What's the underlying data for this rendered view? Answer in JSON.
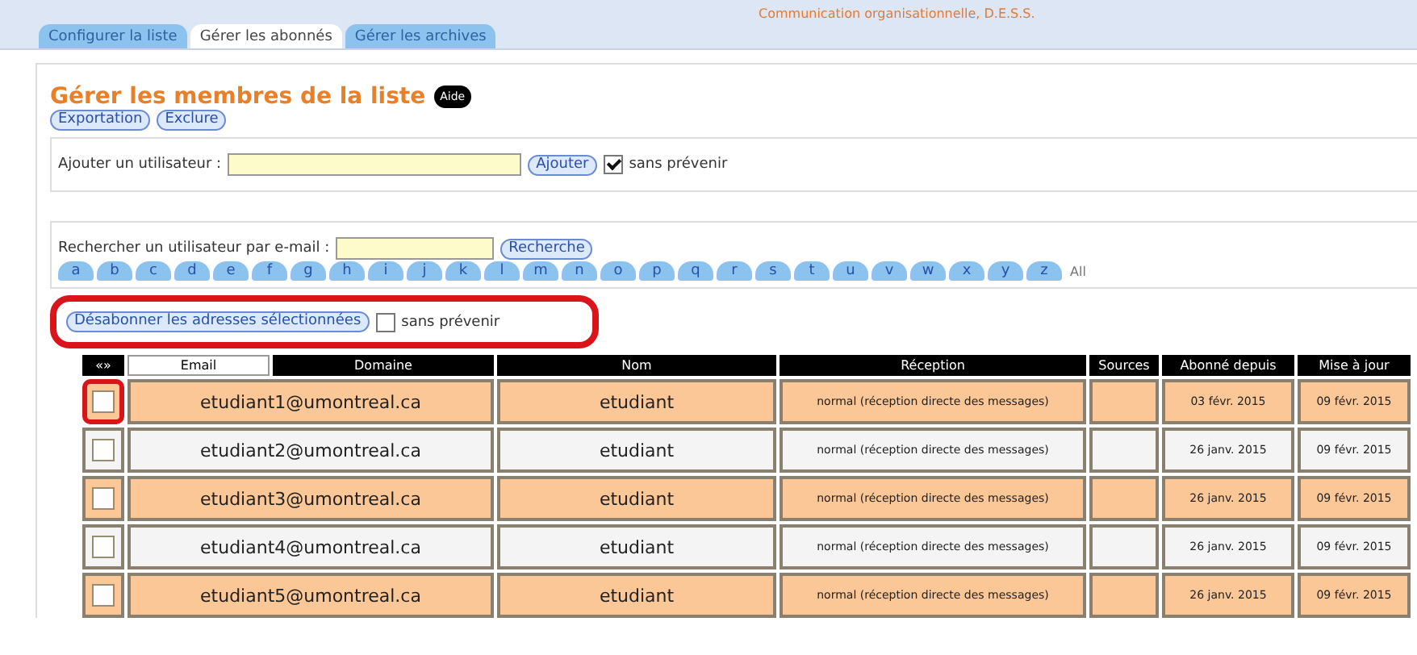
{
  "tabs": [
    {
      "label": "Configurer la liste",
      "selected": false
    },
    {
      "label": "Gérer les abonnés",
      "selected": true
    },
    {
      "label": "Gérer les archives",
      "selected": false
    }
  ],
  "list_title": "Communication organisationnelle, D.E.S.S.",
  "heading": "Gérer les membres de la liste",
  "help_badge": "Aide",
  "actions": [
    "Exportation",
    "Exclure"
  ],
  "add_user": {
    "label": "Ajouter un utilisateur :",
    "button": "Ajouter",
    "quiet_checked": true,
    "quiet_label": "sans prévenir"
  },
  "search": {
    "label": "Rechercher un utilisateur par e-mail :",
    "button": "Recherche"
  },
  "letters": [
    "a",
    "b",
    "c",
    "d",
    "e",
    "f",
    "g",
    "h",
    "i",
    "j",
    "k",
    "l",
    "m",
    "n",
    "o",
    "p",
    "q",
    "r",
    "s",
    "t",
    "u",
    "v",
    "w",
    "x",
    "y",
    "z"
  ],
  "all_letters": "All",
  "unsubscribe": {
    "button": "Désabonner les adresses sélectionnées",
    "quiet_checked": false,
    "quiet_label": "sans prévenir",
    "highlighted": true
  },
  "table": {
    "columns": [
      {
        "label": "«»",
        "selected": false
      },
      {
        "label": "Email",
        "selected": true
      },
      {
        "label": "Domaine",
        "selected": false
      },
      {
        "label": "Nom",
        "selected": false
      },
      {
        "label": "Réception",
        "selected": false
      },
      {
        "label": "Sources",
        "selected": false
      },
      {
        "label": "Abonné depuis",
        "selected": false
      },
      {
        "label": "Mise à jour",
        "selected": false
      }
    ],
    "rows": [
      {
        "checked": false,
        "highlighted": true,
        "email": "etudiant1@umontreal.ca",
        "name": "etudiant",
        "reception": "normal (réception directe des messages)",
        "since": "03 févr. 2015",
        "updated": "09 févr. 2015"
      },
      {
        "checked": false,
        "highlighted": false,
        "email": "etudiant2@umontreal.ca",
        "name": "etudiant",
        "reception": "normal (réception directe des messages)",
        "since": "26 janv. 2015",
        "updated": "09 févr. 2015"
      },
      {
        "checked": false,
        "highlighted": false,
        "email": "etudiant3@umontreal.ca",
        "name": "etudiant",
        "reception": "normal (réception directe des messages)",
        "since": "26 janv. 2015",
        "updated": "09 févr. 2015"
      },
      {
        "checked": false,
        "highlighted": false,
        "email": "etudiant4@umontreal.ca",
        "name": "etudiant",
        "reception": "normal (réception directe des messages)",
        "since": "26 janv. 2015",
        "updated": "09 févr. 2015"
      },
      {
        "checked": false,
        "highlighted": false,
        "email": "etudiant5@umontreal.ca",
        "name": "etudiant",
        "reception": "normal (réception directe des messages)",
        "since": "26 janv. 2015",
        "updated": "09 févr. 2015"
      }
    ]
  }
}
